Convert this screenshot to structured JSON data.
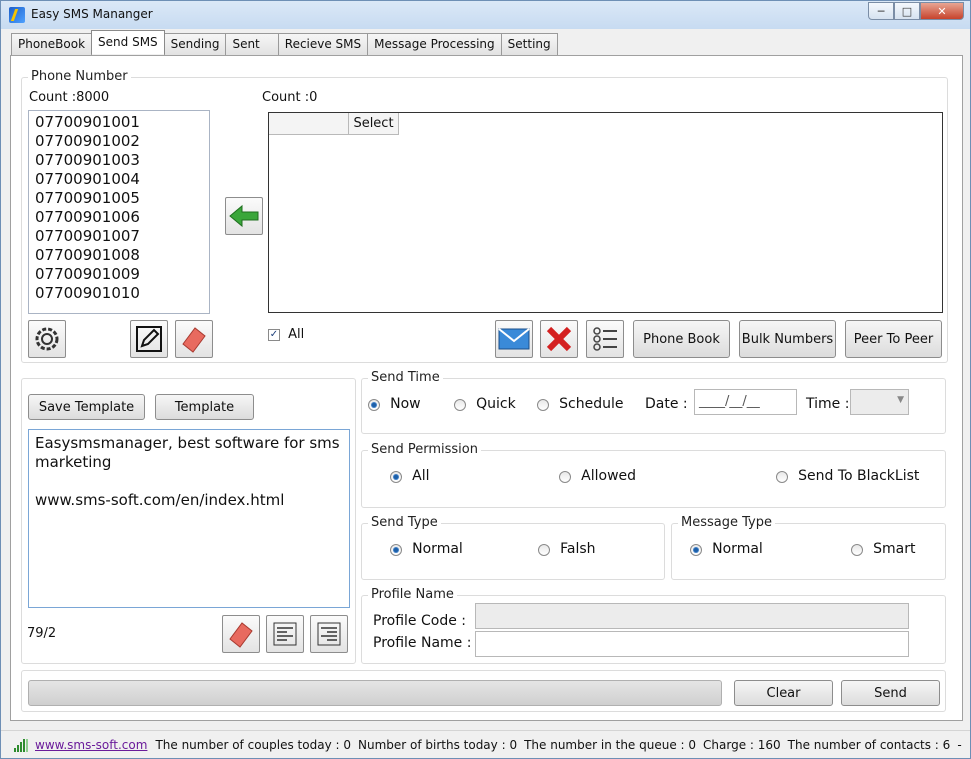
{
  "window": {
    "title": "Easy SMS Mananger"
  },
  "tabs": [
    "PhoneBook",
    "Send SMS",
    "Sending",
    "Sent",
    "Recieve SMS",
    "Message Processing",
    "Setting"
  ],
  "phone_group": {
    "title": "Phone Number",
    "left_count": "Count :8000",
    "right_count": "Count :0",
    "numbers": [
      "07700901001",
      "07700901002",
      "07700901003",
      "07700901004",
      "07700901005",
      "07700901006",
      "07700901007",
      "07700901008",
      "07700901009",
      "07700901010"
    ],
    "grid_header_select": "Select",
    "all_label": "All",
    "all_checked": true,
    "phone_book_label": "Phone Book",
    "bulk_numbers_label": "Bulk Numbers",
    "peer_to_peer_label": "Peer To Peer"
  },
  "template": {
    "save_label": "Save Template",
    "template_label": "Template",
    "message": "Easysmsmanager, best software for sms marketing\n\nwww.sms-soft.com/en/index.html",
    "char_count": "79/2"
  },
  "send_time": {
    "title": "Send Time",
    "options": [
      "Now",
      "Quick",
      "Schedule"
    ],
    "selected": "Now",
    "date_label": "Date :",
    "date_value": "____/__/__",
    "time_label": "Time :"
  },
  "send_permission": {
    "title": "Send Permission",
    "options": [
      "All",
      "Allowed",
      "Send To BlackList"
    ],
    "selected": "All"
  },
  "send_type": {
    "title": "Send Type",
    "options": [
      "Normal",
      "Falsh"
    ],
    "selected": "Normal"
  },
  "message_type": {
    "title": "Message Type",
    "options": [
      "Normal",
      "Smart"
    ],
    "selected": "Normal"
  },
  "profile": {
    "title": "Profile Name",
    "code_label": "Profile Code :",
    "name_label": "Profile Name :"
  },
  "actions": {
    "clear_label": "Clear",
    "send_label": "Send"
  },
  "status": {
    "link": "www.sms-soft.com",
    "couples": "The number of couples today : 0",
    "births": "Number of births today : 0",
    "queue": "The number in the queue : 0",
    "charge": "Charge : 160",
    "contacts": "The number of contacts : 6",
    "tail": "-"
  },
  "colors": {
    "accent": "#3d7fc8",
    "link": "#6a1b9a",
    "arrow": "#3aa63a",
    "eraser": "#e86a5f",
    "delete": "#d42020"
  }
}
